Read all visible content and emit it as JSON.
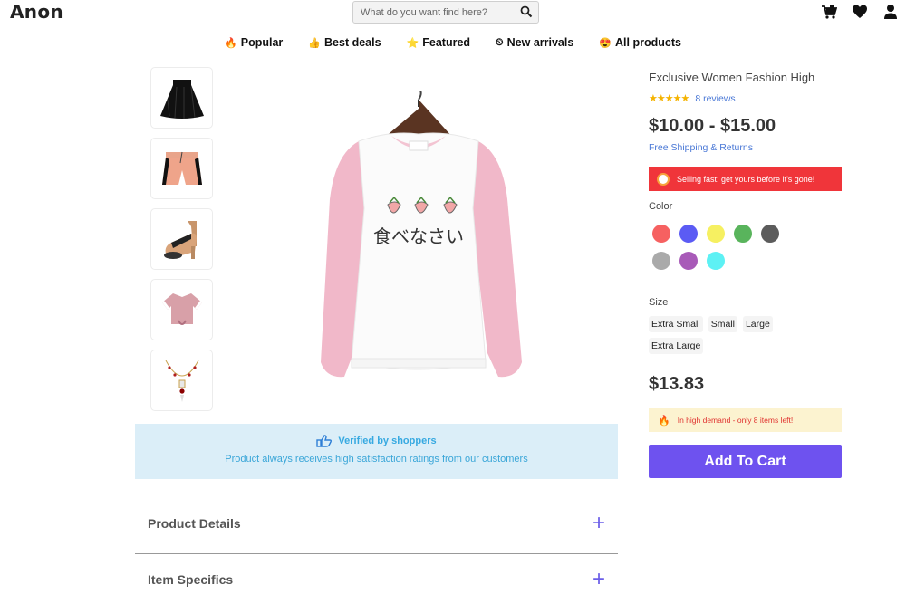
{
  "header": {
    "logo": "Anon",
    "search_placeholder": "What do you want find here?",
    "icons": [
      "cart-icon",
      "heart-icon",
      "user-icon"
    ]
  },
  "nav": [
    {
      "emoji": "🔥",
      "label": "Popular"
    },
    {
      "emoji": "👍",
      "label": "Best deals"
    },
    {
      "emoji": "⭐",
      "label": "Featured"
    },
    {
      "emoji": "⏲",
      "label": "New arrivals"
    },
    {
      "emoji": "😍",
      "label": "All products"
    }
  ],
  "thumbnails": [
    "skirt",
    "shorts",
    "heels",
    "crop-top",
    "necklace"
  ],
  "main_image": {
    "text_jp": "食べなさい"
  },
  "verified": {
    "title": "Verified by shoppers",
    "subtitle": "Product always receives high satisfaction ratings from our customers"
  },
  "accordions": [
    {
      "label": "Product Details",
      "icon": "+"
    },
    {
      "label": "Item Specifics",
      "icon": "+"
    }
  ],
  "product": {
    "title": "Exclusive Women Fashion High",
    "rating_stars": "★★★★★",
    "reviews": "8 reviews",
    "price_range": "$10.00 - $15.00",
    "shipping": "Free Shipping & Returns",
    "selling_fast": "Selling fast: get yours before it's gone!",
    "color_label": "Color",
    "colors": [
      "#f66161",
      "#5b5bf4",
      "#f6f061",
      "#59b45c",
      "#5c5c5c",
      "#aaaaaa",
      "#a85ab8",
      "#5df1f4"
    ],
    "size_label": "Size",
    "sizes": [
      "Extra Small",
      "Small",
      "Large",
      "Extra Large"
    ],
    "price": "$13.83",
    "demand": "In high demand - only 8 items left!",
    "add_to_cart": "Add To Cart"
  }
}
